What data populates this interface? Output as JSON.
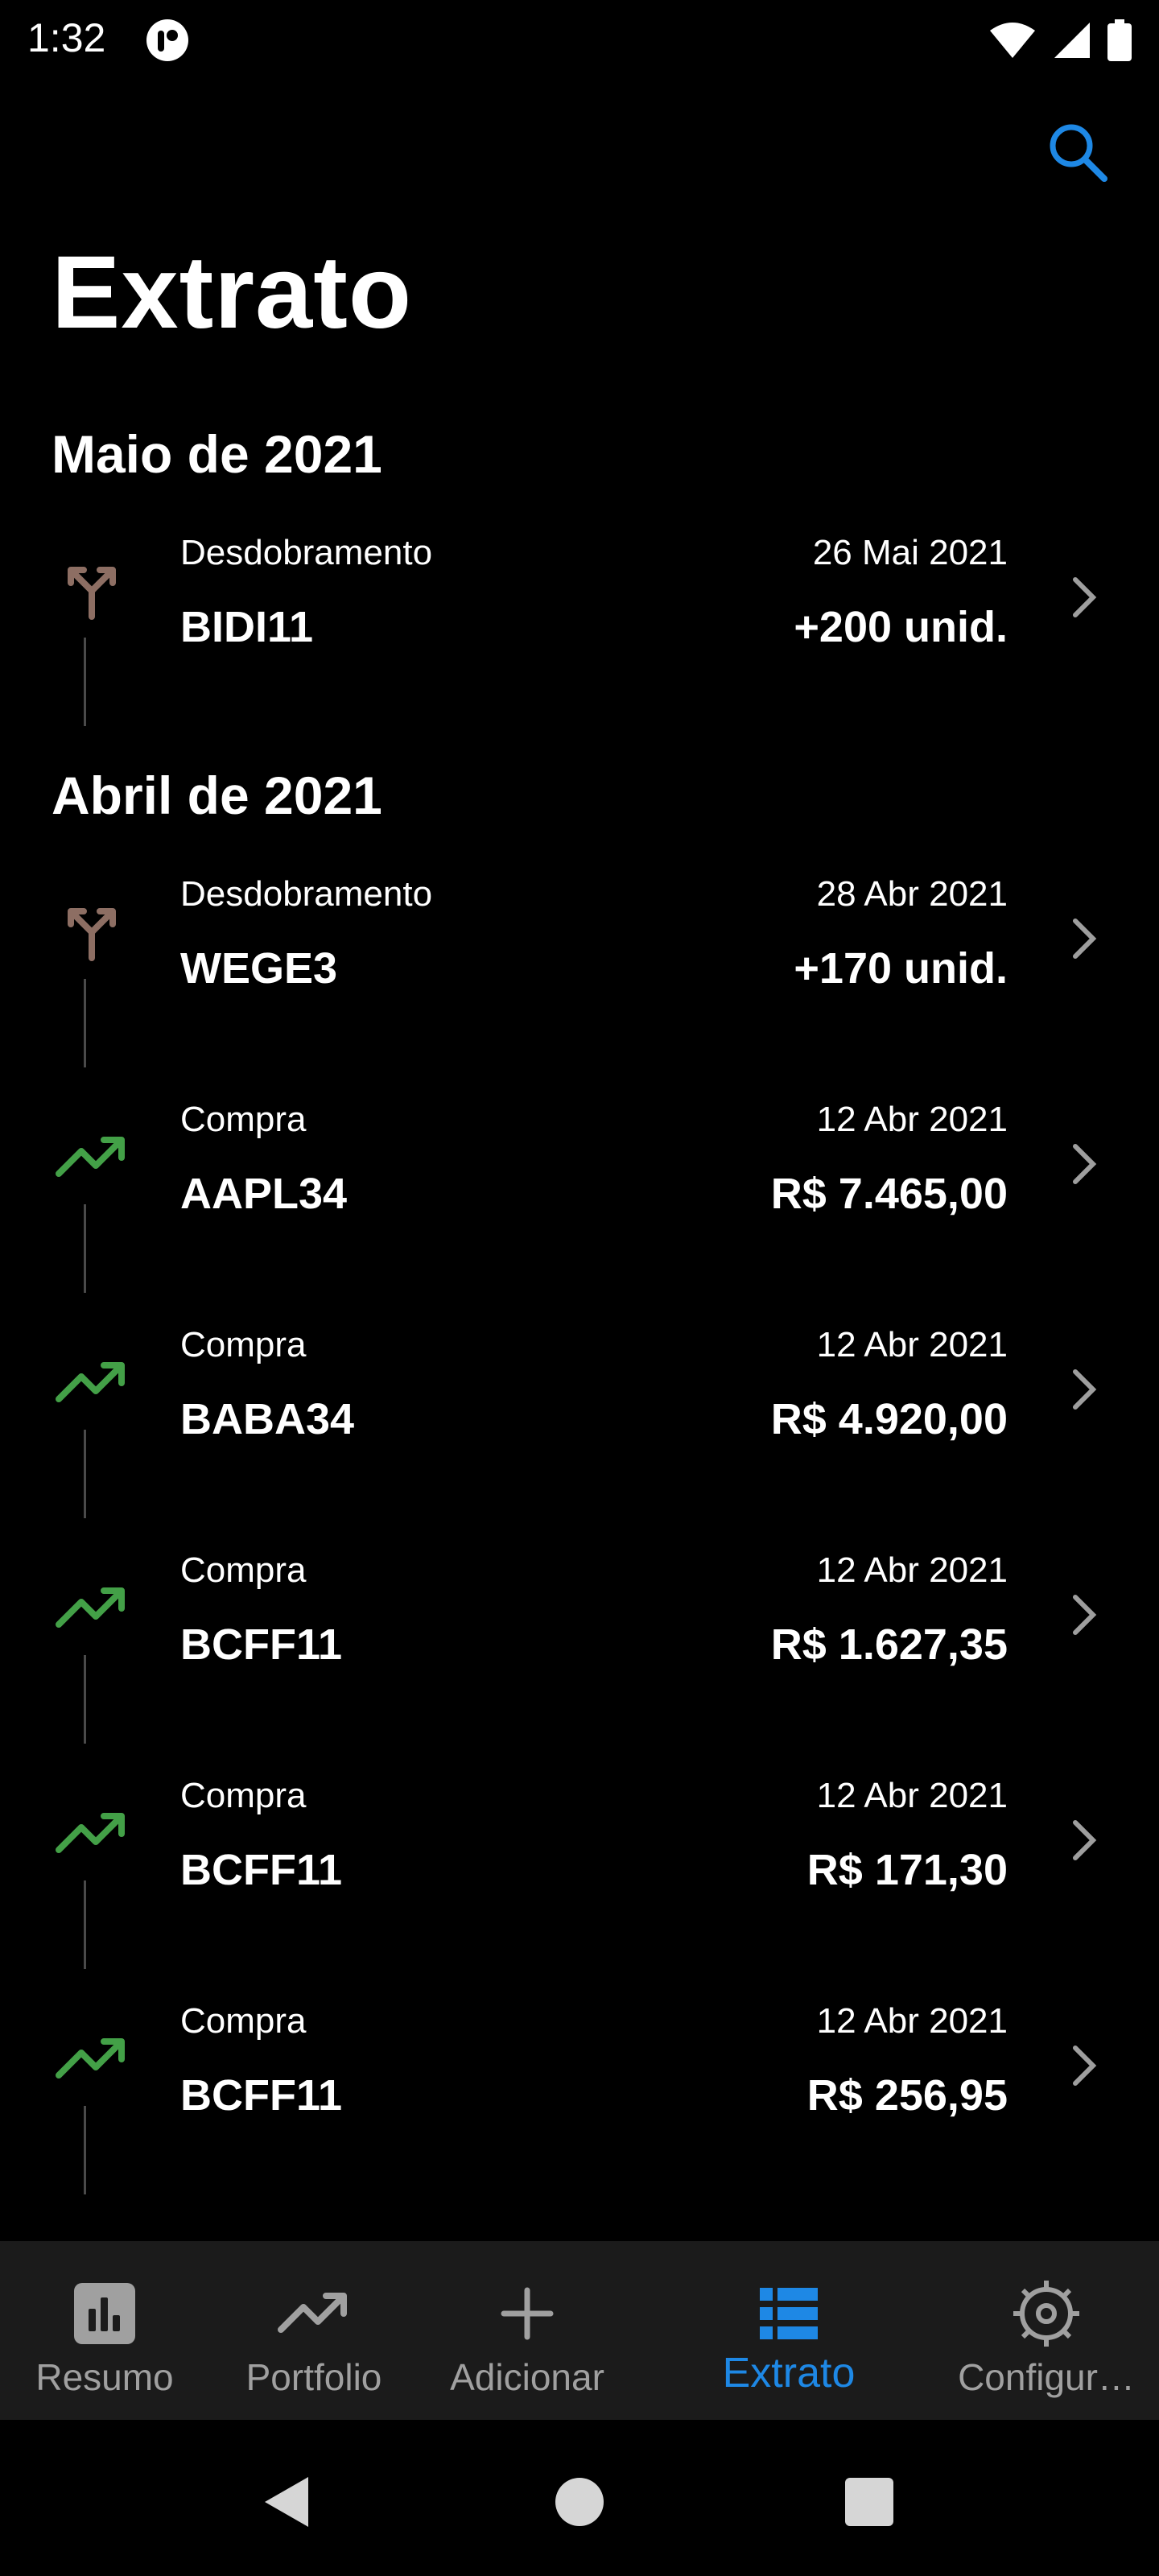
{
  "status_bar": {
    "time": "1:32"
  },
  "header": {
    "title": "Extrato"
  },
  "sections": [
    {
      "title": "Maio de 2021",
      "items": [
        {
          "type": "Desdobramento",
          "date": "26 Mai 2021",
          "ticker": "BIDI11",
          "amount": "+200 unid.",
          "icon": "split-icon"
        }
      ]
    },
    {
      "title": "Abril de 2021",
      "items": [
        {
          "type": "Desdobramento",
          "date": "28 Abr 2021",
          "ticker": "WEGE3",
          "amount": "+170 unid.",
          "icon": "split-icon"
        },
        {
          "type": "Compra",
          "date": "12 Abr 2021",
          "ticker": "AAPL34",
          "amount": "R$ 7.465,00",
          "icon": "trending-up-icon"
        },
        {
          "type": "Compra",
          "date": "12 Abr 2021",
          "ticker": "BABA34",
          "amount": "R$ 4.920,00",
          "icon": "trending-up-icon"
        },
        {
          "type": "Compra",
          "date": "12 Abr 2021",
          "ticker": "BCFF11",
          "amount": "R$ 1.627,35",
          "icon": "trending-up-icon"
        },
        {
          "type": "Compra",
          "date": "12 Abr 2021",
          "ticker": "BCFF11",
          "amount": "R$ 171,30",
          "icon": "trending-up-icon"
        },
        {
          "type": "Compra",
          "date": "12 Abr 2021",
          "ticker": "BCFF11",
          "amount": "R$ 256,95",
          "icon": "trending-up-icon"
        }
      ]
    }
  ],
  "bottom_nav": {
    "items": [
      {
        "label": "Resumo",
        "icon": "bar-chart-icon"
      },
      {
        "label": "Portfolio",
        "icon": "trending-up-icon"
      },
      {
        "label": "Adicionar",
        "icon": "plus-icon"
      },
      {
        "label": "Extrato",
        "icon": "list-icon",
        "active": true
      },
      {
        "label": "Configur…",
        "icon": "gear-icon"
      }
    ]
  },
  "colors": {
    "accent": "#1e88e5",
    "split": "#8d6e63",
    "buy": "#43a047",
    "nav_bg": "#1b1b1b",
    "background": "#000000"
  }
}
